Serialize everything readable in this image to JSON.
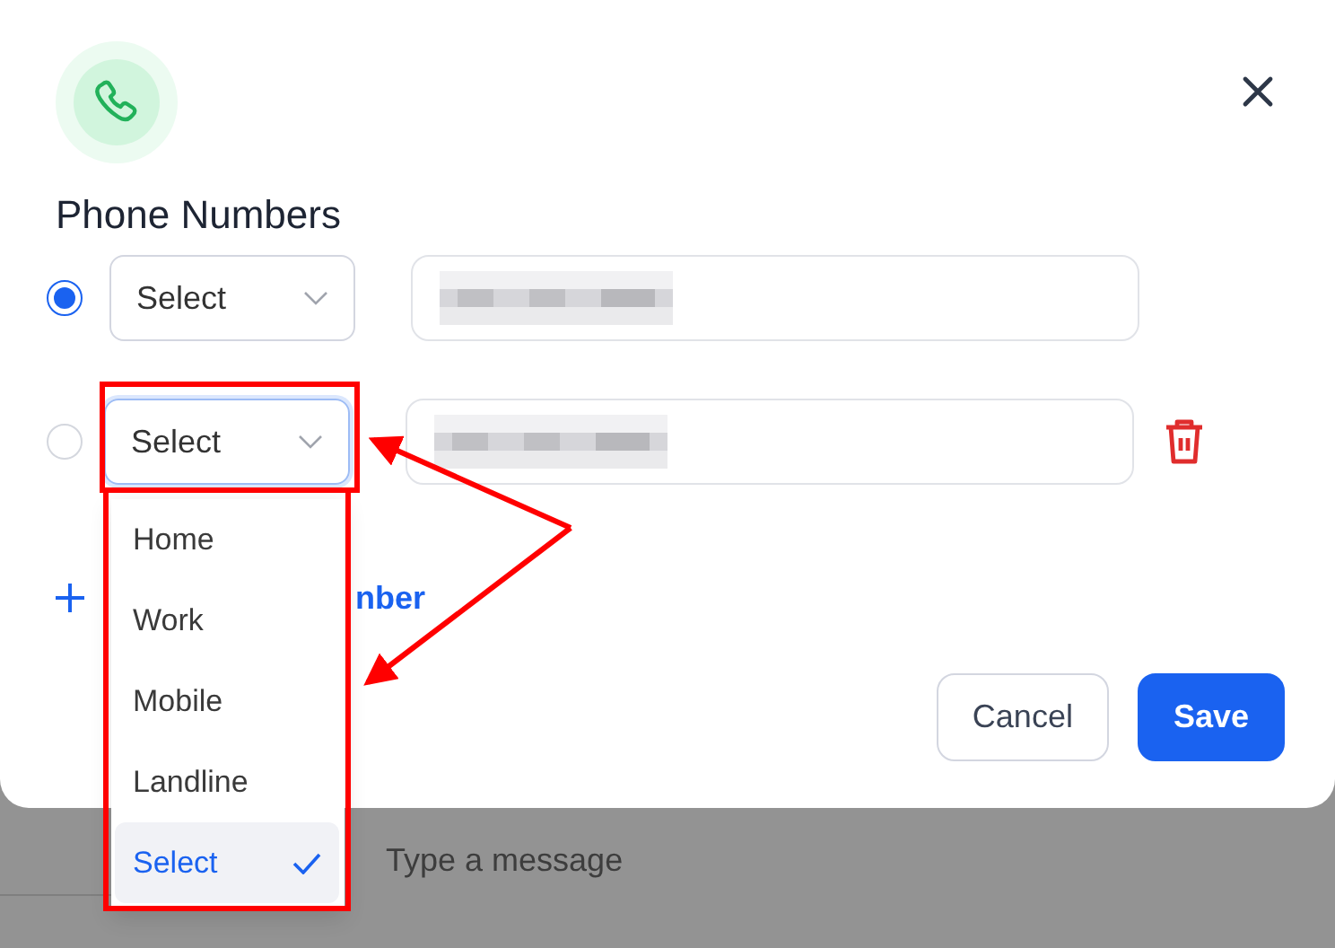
{
  "dialog": {
    "title": "Phone Numbers"
  },
  "phones": [
    {
      "selected": true,
      "type": "Select",
      "focused": false,
      "deletable": false
    },
    {
      "selected": false,
      "type": "Select",
      "focused": true,
      "deletable": true
    }
  ],
  "add_link": "nber",
  "buttons": [
    {
      "label": "Cancel",
      "kind": "secondary"
    },
    {
      "label": "Save",
      "kind": "primary"
    }
  ],
  "dropdown": {
    "options": [
      {
        "label": "Home",
        "selected": false
      },
      {
        "label": "Work",
        "selected": false
      },
      {
        "label": "Mobile",
        "selected": false
      },
      {
        "label": "Landline",
        "selected": false
      },
      {
        "label": "Select",
        "selected": true
      }
    ]
  },
  "background": {
    "message_placeholder": "Type a message"
  }
}
